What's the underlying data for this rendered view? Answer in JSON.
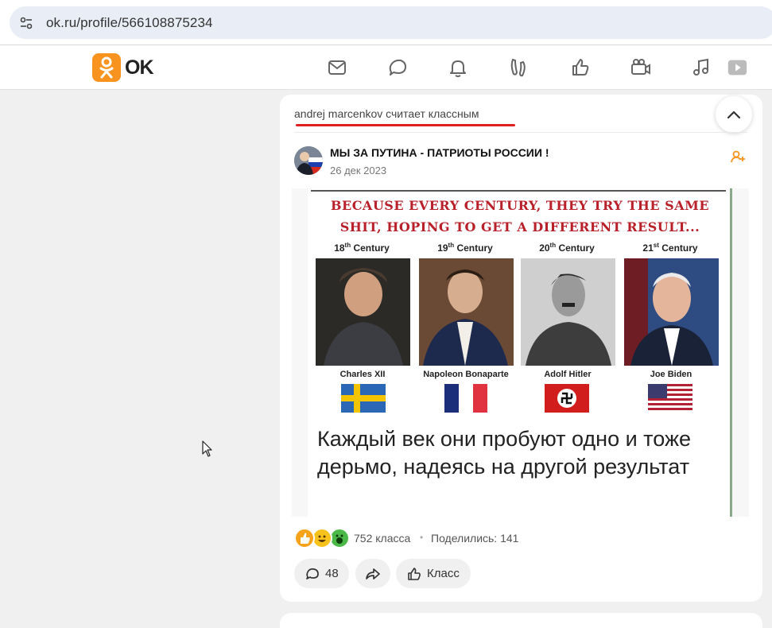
{
  "browser": {
    "url": "ok.ru/profile/566108875234",
    "site_info_icon": "tune-icon"
  },
  "header": {
    "logo_text": "OK",
    "brand_color": "#f7931e",
    "nav_icons": [
      "mail-icon",
      "chat-icon",
      "bell-icon",
      "guests-icon",
      "like-icon",
      "video-camera-icon",
      "music-icon",
      "video-icon"
    ]
  },
  "post": {
    "liked_by_text": "andrej marcenkov считает классным",
    "group_name": "МЫ ЗА ПУТИНА - ПАТРИОТЫ РОССИИ !",
    "date": "26 дек 2023",
    "image": {
      "headline_line1": "Because every century, they try the same",
      "headline_line2": "shit, hoping to get a different result...",
      "centuries": [
        {
          "label": "18th Century",
          "sup": "th",
          "num": "18",
          "name": "Charles XII",
          "flag": "sweden"
        },
        {
          "label": "19th Century",
          "sup": "th",
          "num": "19",
          "name": "Napoleon Bonaparte",
          "flag": "france"
        },
        {
          "label": "20th Century",
          "sup": "th",
          "num": "20",
          "name": "Adolf Hitler",
          "flag": "nazi-germany"
        },
        {
          "label": "21st Century",
          "sup": "st",
          "num": "21",
          "name": "Joe Biden",
          "flag": "usa"
        }
      ],
      "caption_ru": "Каждый век они пробуют одно и тоже дерьмо, надеясь на другой результат"
    },
    "reactions_count": "752 класса",
    "shares": "Поделились: 141",
    "comments_count": "48",
    "class_label": "Класс"
  },
  "colors": {
    "accent_orange": "#f7931e",
    "underline_red": "#e02020",
    "meme_red": "#b8202a"
  }
}
